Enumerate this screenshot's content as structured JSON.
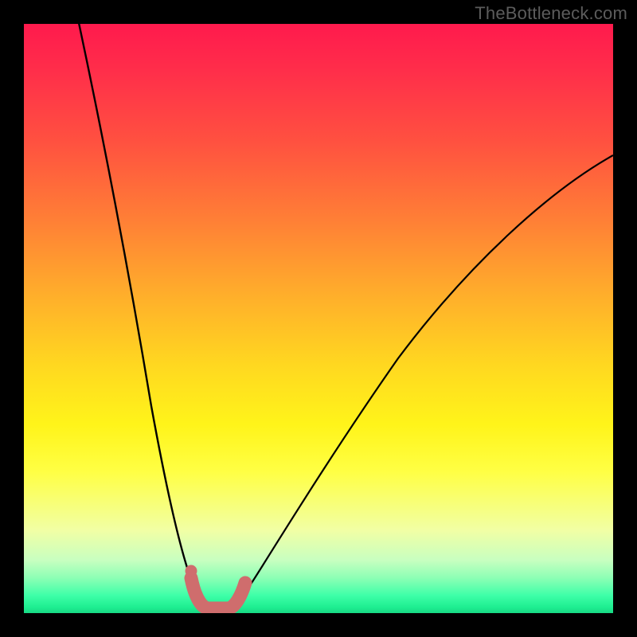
{
  "watermark": {
    "text": "TheBottleneck.com"
  },
  "chart_data": {
    "type": "line",
    "title": "",
    "xlabel": "",
    "ylabel": "",
    "x_range": [
      0,
      740
    ],
    "y_range_percent": [
      0,
      100
    ],
    "optimum_x_fraction": 0.32,
    "series": [
      {
        "name": "left-branch",
        "x": [
          65,
          85,
          105,
          125,
          145,
          165,
          185,
          200,
          212,
          221,
          227
        ],
        "y_percent": [
          100,
          83,
          67,
          52,
          38,
          26,
          16,
          9,
          4,
          1,
          0
        ]
      },
      {
        "name": "right-branch",
        "x": [
          263,
          275,
          295,
          325,
          365,
          415,
          475,
          545,
          625,
          700,
          740
        ],
        "y_percent": [
          0,
          2,
          6,
          12,
          20,
          30,
          41,
          53,
          65,
          74,
          78
        ]
      }
    ],
    "highlight": {
      "name": "optimum-band",
      "color": "#cf6d6d",
      "x": [
        208,
        216,
        224,
        232,
        240,
        248,
        256,
        264,
        272
      ],
      "y_percent": [
        6,
        2,
        0,
        0,
        0,
        0,
        0,
        1,
        3
      ]
    },
    "highlight_dot": {
      "x": 210,
      "y_percent": 7,
      "color": "#cf6d6d"
    },
    "background_gradient": true
  }
}
